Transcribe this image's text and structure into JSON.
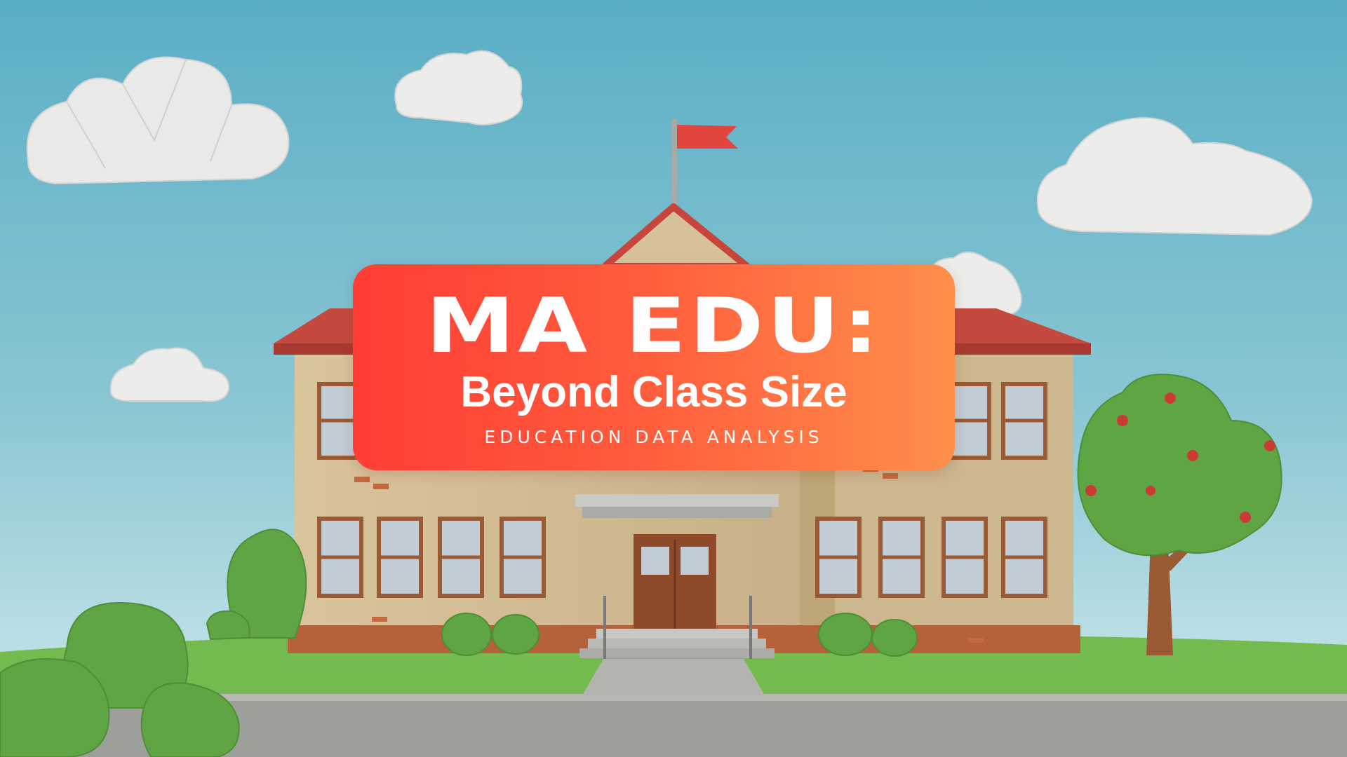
{
  "banner": {
    "title": "MA EDU:",
    "subtitle": "Beyond Class Size",
    "tagline": "EDUCATION DATA ANALYSIS"
  },
  "colors": {
    "sky_top": "#5fb0c8",
    "sky_bottom": "#c9e6ec",
    "card_start": "#ff3d35",
    "card_end": "#ff8f4b",
    "roof": "#c8453b",
    "wall": "#d8c39a",
    "grass": "#72b94e",
    "road": "#9a9c98",
    "flag": "#e2453e"
  },
  "icons": [
    "cloud-icon",
    "flag-icon",
    "school-building-icon",
    "tree-icon",
    "bush-icon"
  ]
}
